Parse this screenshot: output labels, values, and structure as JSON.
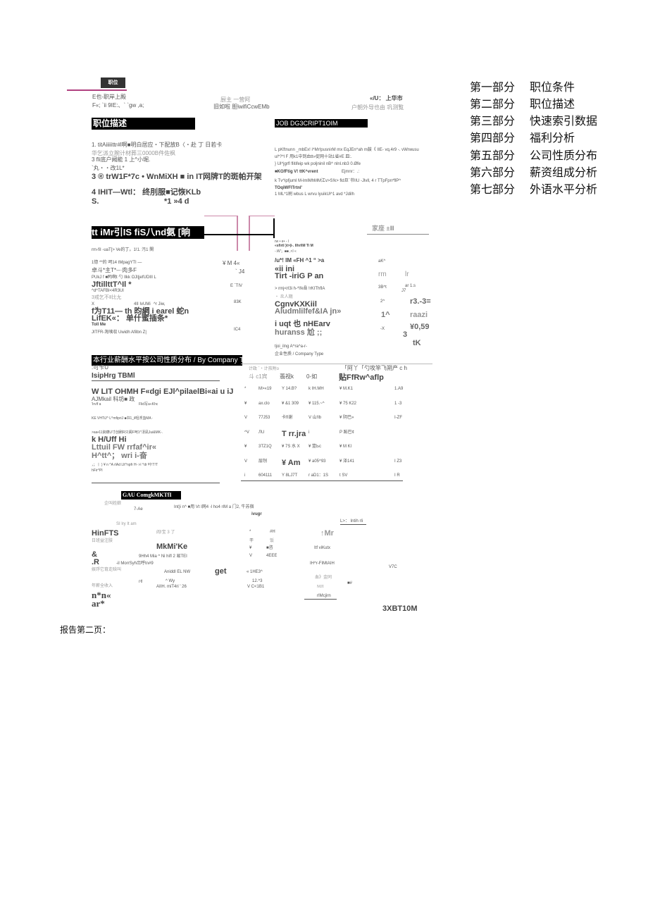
{
  "toc": [
    {
      "part": "第一部分",
      "title": "职位条件"
    },
    {
      "part": "第二部分",
      "title": "职位描述"
    },
    {
      "part": "第三部分",
      "title": "快速索引数据"
    },
    {
      "part": "第四部分",
      "title": "福利分析"
    },
    {
      "part": "第五部分",
      "title": "公司性质分布"
    },
    {
      "part": "第六部分",
      "title": "薪资组成分析"
    },
    {
      "part": "第七部分",
      "title": "外语水平分析"
    }
  ],
  "header": {
    "logo": "职位",
    "c1a": "E也-职岸上殿",
    "c1b": "F«; `ii 9IE:、` `gw ,a;",
    "c2a": "厨主 一营阿",
    "c2b": "旧如啦 胆iwifiCcwEMb",
    "c3a": "«/U： 上华市",
    "c3b": "户朝外导也由 巩测覧"
  },
  "desc": {
    "title_cn": "职位描述",
    "title_en": "JOB DG3CRIPT1OIM",
    "left": [
      "1. titAiiiiittr#l啊■明白居应・下配放B〈・赴 丁 日若卡",
      "华乞派立腕计材葬三0000B件佐枫",
      "3 fli底户阙能 1 上^小堀.",
      "`丸・・改1L*",
      "3   ® trW1F*7c •  WnMiXH ■ in IT网牌T的斑帕开架",
      "4   IHIT—Wtl：  终刖服■记恢KLb",
      "S.",
      "*1 »4 d"
    ],
    "right": [
      "L pKftnunn _mbEx! i^Mr!pusnirM mx EqJEn^ah m鼓《 IIE- vq.4r9 -. vWrwusu",
      "ul*?*l F 用k1中到血tt»促网十站1省#E 皿:.",
      "} Ul^jgrfl flitifeip wk poljninil nB^ nlnl.nb3 0.Øfe",
      "■KGfFtig V! ttK^vrent",
      "Ejmnr：.:",
      "k Tv^ipfjuml M-lmlMhMM江v>S!k> fld旦`书!IU -Jlvll, 4 r TTpFpn*flP^",
      "TOqiWFlTrtnl'",
      "1 ML*1刷 wbus L wrvu lyuikUl^1 avd *Jdilh"
    ]
  },
  "quick": {
    "title": "tt iMr引IS fiS八nd氨 [晌",
    "left": [
      "rm-fiI -uaT[> Ve的丁。1!1. 汚1 関",
      "1惚 **的 呵14 tMpagYTI —",
      "卓斗*主T*--·肉多F",
      "PUkJ f ■眄啊t 勺 Ilkk OJl|jefUDIIl L",
      "JftillttT^Il *",
      "^d^TAFBI<4R3Ul",
      "3戒乞不Ⅱ比尢",
      "X",
      "4II IvUMi",
      "^r Jiw,",
      "f为T11— th 昀網 i earel 蛇n",
      "LifEK«：  单什蜜插条*",
      "Toll Me",
      "JITFR-淘咦収  Uwidh Afilbn Z|"
    ],
    "vals": [
      "¥ M 4«",
      "` J4",
      "E `TIV",
      "83K",
      "IC4"
    ],
    "mid": [
      "rw • e• - l",
      "«sfirtl }t>|i-. Ilhrl\\M Ti M",
      "-.W'；■■ ,<l «",
      "/u*! IM «FH ^1   “ >a",
      "«ii ini",
      "Tirt -iriG P an",
      "> rmj<rl3i h-*l!k喦 !rKIThflA",
      "・ 炎人期",
      "CgnvKXKiil",
      "Aludmlilfef&IA jn»",
      "i uqt 也 nHEarv",
      "huranss 尬 ;;",
      "tjoi_ilng A^ra^a-r-"
    ],
    "far": [
      "家座  ±Ⅲ",
      "aK^",
      "rm",
      "lr",
      "3B^t",
      "ar 1.s",
      "J7",
      "2^",
      "r3.-3=",
      "1^",
      "raazi",
      "-X",
      "¥0,59",
      "3",
      "tK"
    ]
  },
  "company": {
    "title": "本行业薪酬水平按公司性质分布 / By Company Type",
    "sub": "企业性质 / Company Type",
    "left": [
      ":可卡U",
      "IsipHrg TBMl",
      "W LIT OHMH F«dgi EJl^pilaelBi«ai u iJ",
      "AJMkail 科坊■ 政",
      "'IrvIf a",
      "Flid写a«Khc",
      "KE VHTiJ^ L^mfipriJ ■书1_il咀浮血MA ·",
      ">aa•11資葫U寸创刷R只阖F呵1^冴凪Jui&MK-.",
      "k H/Uff Hi",
      "Lttuil FW rrfaf^ir«",
      "H^tt^；  wri i-奋",
      "，；丨 ) ¥ n ^A rlAd Llt^npfr H- i-l ^dr 叶!T!Т",
      "hFir^PI"
    ],
    "head": [
      "计政 `・计孩附o",
      "「阿丫「勺攻竿飞朔产 c h",
      "斗 c1宾",
      "翡视k",
      "0-如",
      "贴FfRw^aflp"
    ],
    "rows": [
      [
        "*",
        "M>«19",
        "Y 14.B?",
        "k  IH.MH",
        "¥  M.K1",
        "1.A9"
      ],
      [
        "¥",
        "ax.clo",
        "¥    &1 309",
        "¥  115.~^",
        "¥  75 K22",
        "1 -3"
      ],
      [
        "V",
        "77J53",
        "卡fI谢",
        "V  山!lb",
        "¥  阴巴»",
        "I-ZF"
      ],
      [
        "^V",
        "ЛU",
        "T rr.jra",
        "i",
        "P  跖巴¢",
        ""
      ],
      [
        "¥",
        "3TZ1Q",
        "¥ 7S 水 X",
        "¥       筮Ьc",
        "¥  M Kl",
        ""
      ],
      [
        "V",
        "层刎",
        "¥ Am",
        "¥  a05^93",
        "¥  泽141",
        "I Z3"
      ],
      [
        "i",
        "604111",
        "Y 8LJ7T",
        "r  aD1：1S",
        "t  SV",
        "I R"
      ]
    ]
  },
  "bottom": {
    "title": "GAU ComgkMKTfI",
    "texts": [
      "企叫姓娘",
      "7-Ae",
      "Int}i n^  ■用 Vt I网4 -l ho4 rIM a 门2, 牛苏宿",
      "ivugr",
      "SI lry It am",
      "L>： Intih rli",
      "HinFTS",
      "阎!宝 3 了",
      "*",
      "#H",
      "↑Mr",
      "日班益注肢",
      "干",
      "饭",
      "MkMi'Ke",
      "¥",
      "■咨",
      "Itf viKutx",
      "&",
      "9Hh4 Mia ^ Ni hifl 2 易TEI",
      "V",
      "4EEE",
      ".R",
      "-il MorrSyh岀呼tn#9",
      "IH^r-FIMtAIH",
      "V7C",
      "娱琈它育走晗叫",
      "Aniddl EL NW",
      "get",
      "«   1HE3^",
      "血》金同",
      "г¢",
      "^ Wy",
      "12.^3",
      "■#",
      "年薪全收入",
      "AIIH. miT4ri ' 26",
      "V C<1B1",
      "MJI",
      "n*n«",
      "rIMcjirn",
      "ar*",
      "3XBT10M"
    ]
  },
  "footer": "报告第二页："
}
